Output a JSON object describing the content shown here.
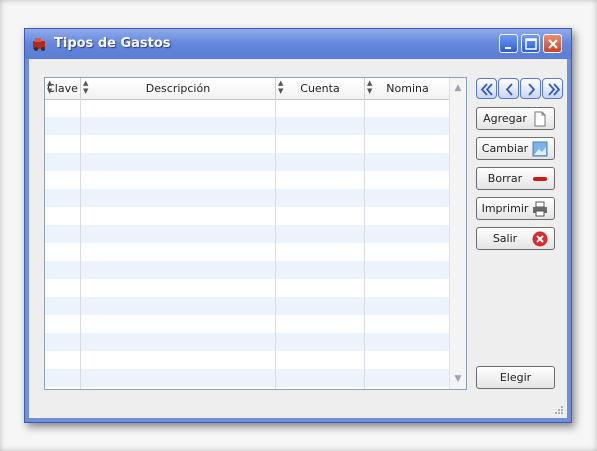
{
  "window": {
    "title": "Tipos de Gastos"
  },
  "grid": {
    "columns": [
      "Clave",
      "Descripción",
      "Cuenta",
      "Nomina"
    ],
    "rows": []
  },
  "nav": {
    "icons": [
      "first-icon",
      "previous-icon",
      "next-icon",
      "last-icon"
    ]
  },
  "buttons": {
    "agregar": "Agregar",
    "cambiar": "Cambiar",
    "borrar": "Borrar",
    "imprimir": "Imprimir",
    "salir": "Salir",
    "elegir": "Elegir"
  },
  "colors": {
    "titlebar": "#6486dc",
    "row_alt": "#edf3fa",
    "close": "#c8442a"
  }
}
